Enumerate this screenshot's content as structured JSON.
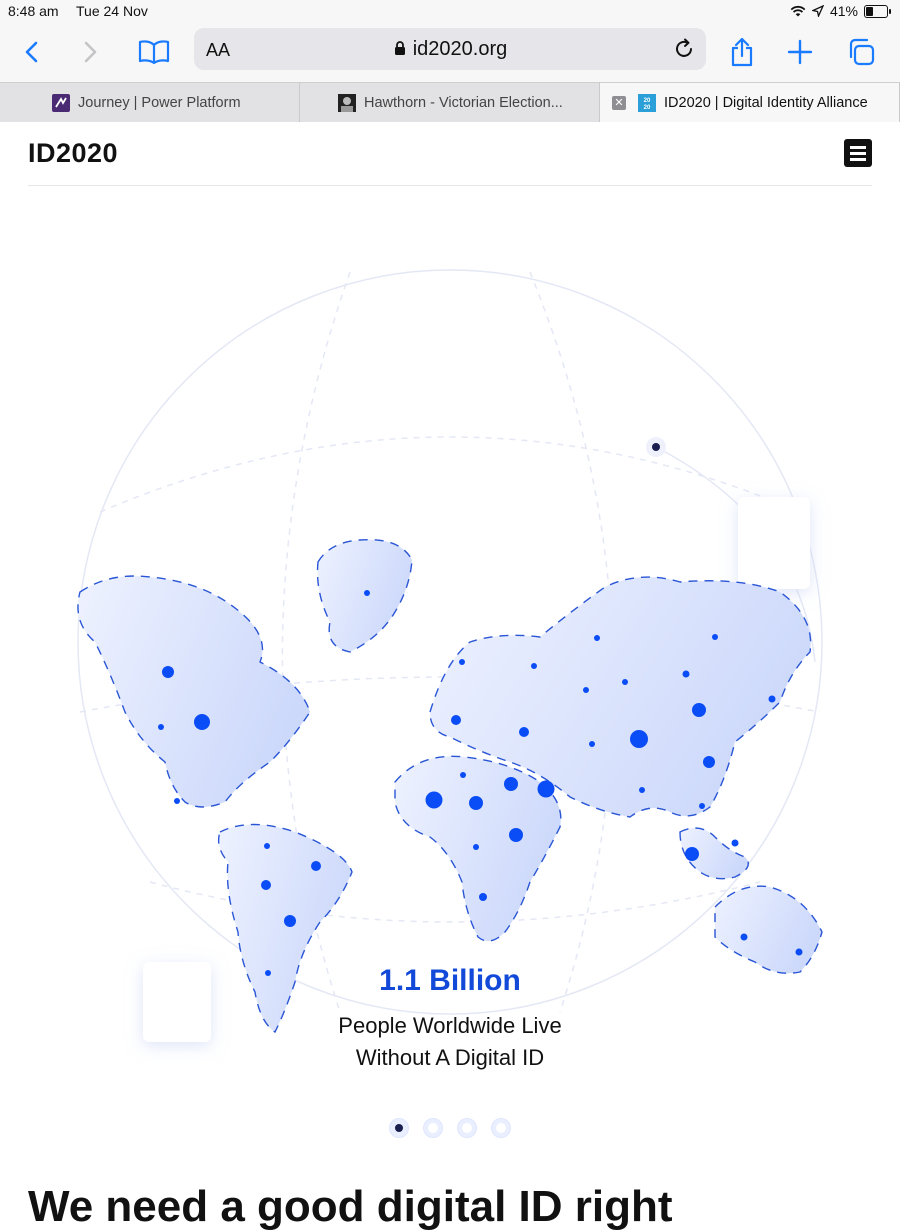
{
  "status_bar": {
    "time": "8:48 am",
    "date": "Tue 24 Nov",
    "battery": "41%",
    "battery_level": 0.41
  },
  "browser": {
    "text_size_label": "AA",
    "url": "id2020.org",
    "tabs": [
      {
        "title": "Journey | Power Platform",
        "active": false
      },
      {
        "title": "Hawthorn - Victorian Election...",
        "active": false
      },
      {
        "title": "ID2020 | Digital Identity Alliance",
        "active": true
      }
    ],
    "accent": "#1a7bff"
  },
  "site": {
    "logo": "ID2020",
    "stat_value": "1.1 Billion",
    "stat_line1": "People Worldwide Live",
    "stat_line2": "Without A Digital ID",
    "slide_count": 4,
    "active_slide": 1,
    "next_heading": "We need a good digital ID right",
    "accent": "#1249d8"
  },
  "icons": [
    "back-icon",
    "forward-icon",
    "bookmarks-icon",
    "lock-icon",
    "reload-icon",
    "share-icon",
    "new-tab-icon",
    "tabs-icon",
    "menu-icon",
    "wifi-icon",
    "location-icon",
    "battery-icon"
  ]
}
